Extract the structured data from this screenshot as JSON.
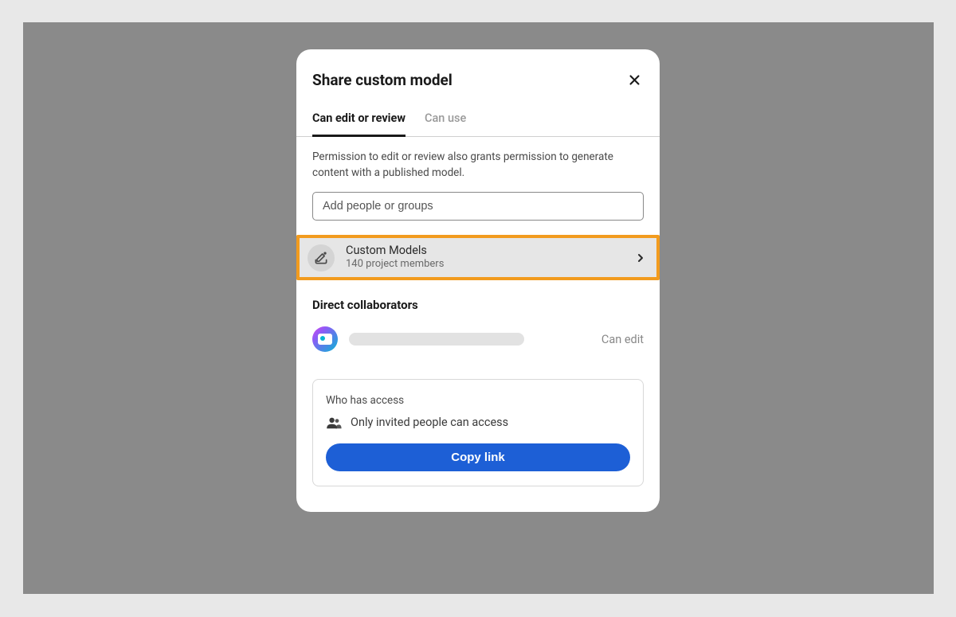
{
  "modal": {
    "title": "Share custom model",
    "tabs": {
      "edit": "Can edit or review",
      "use": "Can use"
    },
    "description": "Permission to edit or review also grants permission to generate content with a published model.",
    "input_placeholder": "Add people or groups",
    "project": {
      "name": "Custom Models",
      "members": "140 project members"
    },
    "collab_section": "Direct collaborators",
    "collaborator": {
      "permission": "Can edit"
    },
    "access": {
      "title": "Who has access",
      "desc": "Only invited people can access",
      "button": "Copy link"
    }
  }
}
